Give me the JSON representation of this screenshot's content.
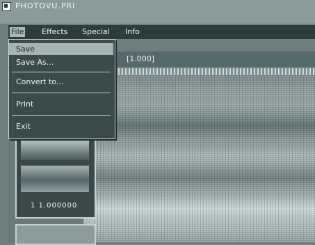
{
  "window": {
    "title": "PHOTOVU.PRI"
  },
  "menubar": {
    "items": [
      {
        "label": "File"
      },
      {
        "label": "Effects"
      },
      {
        "label": "Special"
      },
      {
        "label": "Info"
      }
    ]
  },
  "file_menu": {
    "items": [
      {
        "label": "Save",
        "highlighted": true
      },
      {
        "label": "Save As..."
      },
      {
        "label": "Convert to..."
      },
      {
        "label": "Print"
      },
      {
        "label": "Exit"
      }
    ]
  },
  "document": {
    "title": "[1.000]"
  },
  "thumbnail_panel": {
    "caption": "1 1.000000"
  },
  "colors": {
    "menubar_bg": "#2e3c3d",
    "menu_highlight": "#a5b3b3",
    "frame": "#c7d1d1"
  }
}
